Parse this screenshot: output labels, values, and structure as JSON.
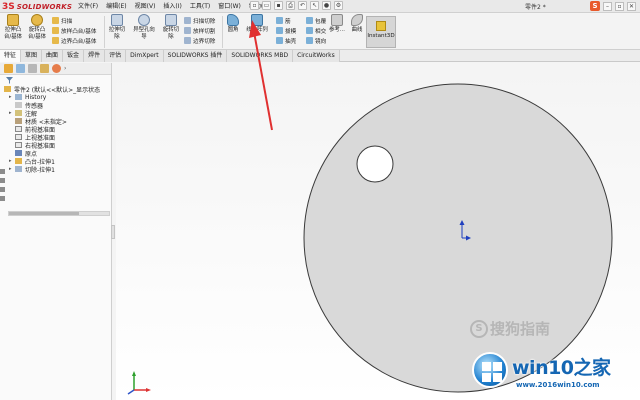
{
  "app": {
    "logo_mark": "3S",
    "logo_text": "SOLIDWORKS",
    "document_title": "零件2 *"
  },
  "menu": [
    "文件(F)",
    "编辑(E)",
    "视图(V)",
    "插入(I)",
    "工具(T)",
    "窗口(W)",
    "帮助(H)"
  ],
  "window_controls": {
    "ime_badge": "S",
    "minimize": "–",
    "restore": "▫",
    "close": "✕"
  },
  "ribbon": {
    "big_tools": [
      {
        "label_1": "拉伸凸",
        "label_2": "台/基体"
      },
      {
        "label_1": "旋转凸",
        "label_2": "台/基体"
      },
      {
        "label_1": "拉伸切",
        "label_2": "除"
      },
      {
        "label_1": "异型孔向",
        "label_2": "导"
      },
      {
        "label_1": "旋转切",
        "label_2": "除"
      },
      {
        "label_1": "圆角",
        "label_2": ""
      },
      {
        "label_1": "线性阵列",
        "label_2": ""
      },
      {
        "label_1": "参考...",
        "label_2": ""
      },
      {
        "label_1": "曲线",
        "label_2": ""
      }
    ],
    "small_tools_group1": [
      "扫描",
      "放样凸台/基体",
      "边界凸台/基体"
    ],
    "small_tools_group2": [
      "扫描切除",
      "放样切割",
      "边界切除"
    ],
    "small_tools_group3": [
      "筋",
      "拔模",
      "抽壳"
    ],
    "small_tools_group4": [
      "包覆",
      "相交",
      "镜向"
    ],
    "instant3d": "Instant3D"
  },
  "tabs": [
    "特征",
    "草图",
    "曲面",
    "钣金",
    "焊件",
    "评估",
    "DimXpert",
    "SOLIDWORKS 插件",
    "SOLIDWORKS MBD",
    "CircuitWorks"
  ],
  "tree": {
    "root": "零件2 (默认<<默认>_显示状态",
    "items": [
      {
        "label": "History",
        "caret": "▸"
      },
      {
        "label": "传感器",
        "caret": ""
      },
      {
        "label": "注解",
        "caret": "▸"
      },
      {
        "label": "材质 <未指定>",
        "caret": ""
      },
      {
        "label": "前视基准面",
        "caret": ""
      },
      {
        "label": "上视基准面",
        "caret": ""
      },
      {
        "label": "右视基准面",
        "caret": ""
      },
      {
        "label": "原点",
        "caret": ""
      },
      {
        "label": "凸台-拉伸1",
        "caret": "▸"
      },
      {
        "label": "切除-拉伸1",
        "caret": "▸"
      }
    ]
  },
  "watermark": {
    "mark": "S",
    "text": "搜狗指南"
  },
  "badge": {
    "brand": "win10之家",
    "url": "www.2016win10.com"
  },
  "colors": {
    "accent_red": "#d8262b",
    "part_fill": "#d9d9d9",
    "part_edge": "#3a3a3a",
    "arrow": "#e03030",
    "badge_blue": "#1466b3"
  }
}
